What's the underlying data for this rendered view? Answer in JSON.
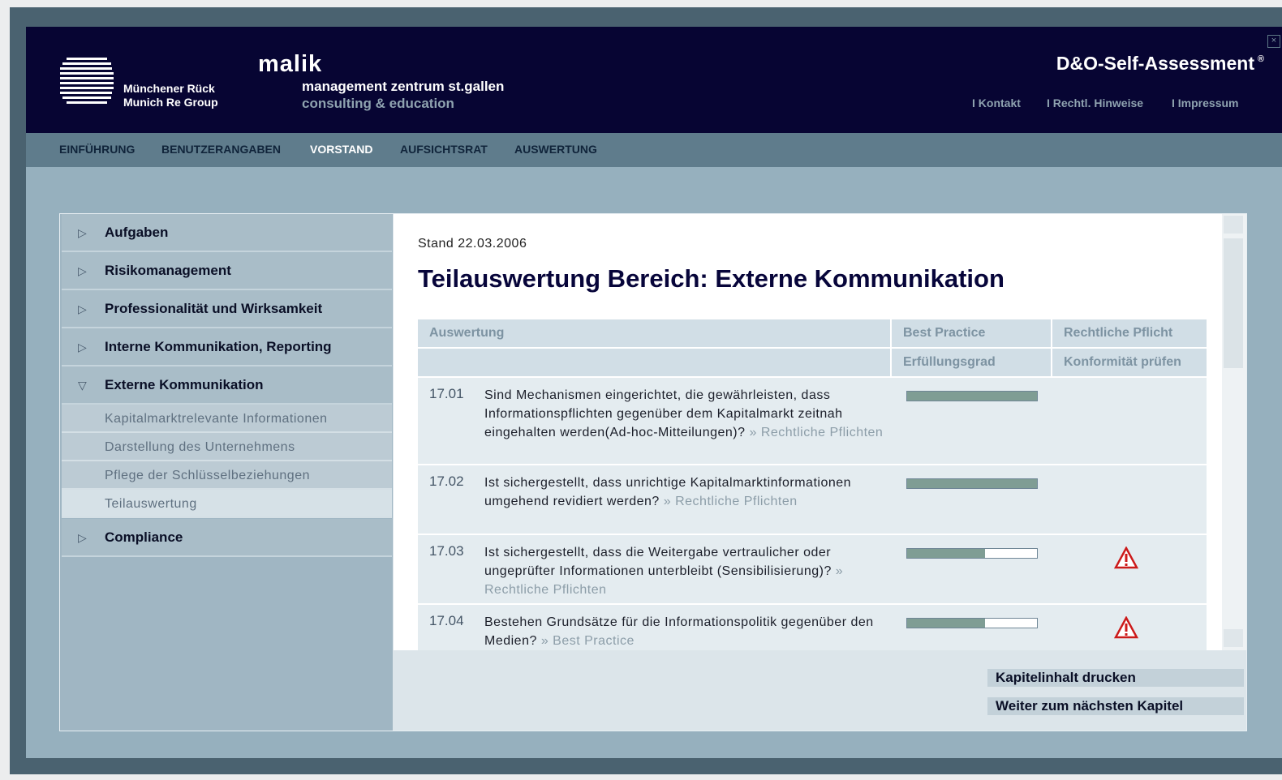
{
  "header": {
    "munich_re_line1": "Münchener Rück",
    "munich_re_line2": "Munich Re Group",
    "malik_brand": "malik",
    "malik_line1": "management zentrum st.gallen",
    "malik_line2": "consulting & education",
    "app_title": "D&O-Self-Assessment",
    "app_title_mark": "®",
    "links": [
      "I Kontakt",
      "I Rechtl. Hinweise",
      "I Impressum"
    ]
  },
  "nav": {
    "tabs": [
      {
        "label": "EINFÜHRUNG",
        "active": false
      },
      {
        "label": "BENUTZERANGABEN",
        "active": false
      },
      {
        "label": "VORSTAND",
        "active": true
      },
      {
        "label": "AUFSICHTSRAT",
        "active": false
      },
      {
        "label": "AUSWERTUNG",
        "active": false
      }
    ]
  },
  "sidebar": {
    "items": [
      {
        "label": "Aufgaben",
        "expanded": false
      },
      {
        "label": "Risikomanagement",
        "expanded": false
      },
      {
        "label": "Professionalität und Wirksamkeit",
        "expanded": false
      },
      {
        "label": "Interne Kommunikation, Reporting",
        "expanded": false
      },
      {
        "label": "Externe Kommunikation",
        "expanded": true
      },
      {
        "label": "Compliance",
        "expanded": false
      }
    ],
    "subitems": [
      {
        "label": "Kapitalmarktrelevante Informationen",
        "selected": false
      },
      {
        "label": "Darstellung des Unternehmens",
        "selected": false
      },
      {
        "label": "Pflege der Schlüsselbeziehungen",
        "selected": false
      },
      {
        "label": "Teilauswertung",
        "selected": true
      }
    ]
  },
  "content": {
    "stand": "Stand 22.03.2006",
    "title": "Teilauswertung Bereich: Externe Kommunikation",
    "table": {
      "header_col1": "Auswertung",
      "header_col2": "Best Practice",
      "header_col3": "Rechtliche Pflicht",
      "subheader_col2": "Erfüllungsgrad",
      "subheader_col3": "Konformität prüfen",
      "rows": [
        {
          "num": "17.01",
          "text": "Sind Mechanismen eingerichtet, die gewährleisten, dass Informationspflichten gegenüber dem Kapitalmarkt zeitnah eingehalten werden(Ad-hoc-Mitteilungen)?",
          "link": "» Rechtliche Pflichten",
          "fulfillment_percent": 100,
          "warning": false
        },
        {
          "num": "17.02",
          "text": "Ist sichergestellt, dass unrichtige Kapitalmarktinformationen umgehend revidiert werden?",
          "link": "» Rechtliche Pflichten",
          "fulfillment_percent": 100,
          "warning": false
        },
        {
          "num": "17.03",
          "text": "Ist sichergestellt, dass die Weitergabe vertraulicher oder ungeprüfter Informationen unterbleibt (Sensibilisierung)?",
          "link": "» Rechtliche Pflichten",
          "fulfillment_percent": 60,
          "warning": true
        },
        {
          "num": "17.04",
          "text": "Bestehen Grundsätze für die Informationspolitik gegenüber den Medien?",
          "link": "» Best Practice",
          "fulfillment_percent": 60,
          "warning": true
        }
      ]
    }
  },
  "actions": {
    "print_label": "Kapitelinhalt drucken",
    "next_label": "Weiter zum nächsten Kapitel"
  },
  "colors": {
    "header_bg": "#070533",
    "nav_bg": "#5f7c8c",
    "bar_fill": "#7f9d94",
    "warning": "#cc1a1a"
  },
  "icons": {
    "collapsed": "triangle-right-icon",
    "expanded": "triangle-down-icon",
    "warning": "warning-icon"
  }
}
